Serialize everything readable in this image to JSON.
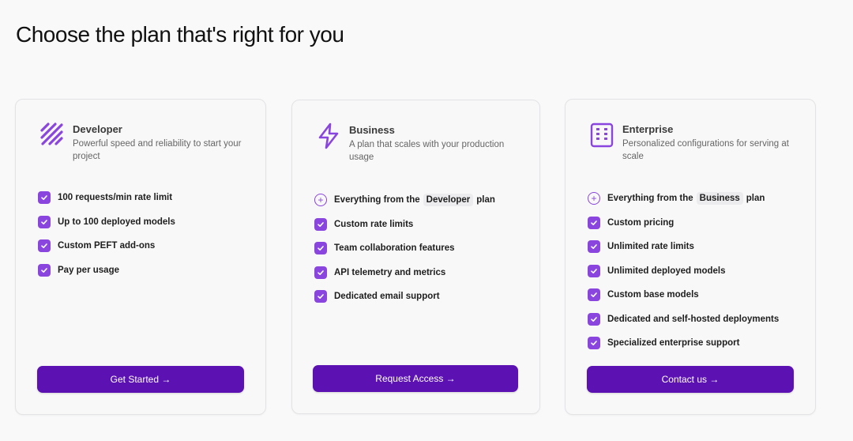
{
  "page": {
    "title": "Choose the plan that's right for you"
  },
  "plans": [
    {
      "name": "Developer",
      "description": "Powerful speed and reliability to start your project",
      "icon": "diagonal-stripes-icon",
      "features": [
        "100 requests/min rate limit",
        "Up to 100 deployed models",
        "Custom PEFT add-ons",
        "Pay per usage"
      ],
      "cta": "Get Started →"
    },
    {
      "name": "Business",
      "description": "A plan that scales with your production usage",
      "icon": "lightning-bolt-icon",
      "inherits": {
        "prefix": "Everything from the",
        "plan": "Developer",
        "suffix": "plan"
      },
      "features": [
        "Custom rate limits",
        "Team collaboration features",
        "API telemetry and metrics",
        "Dedicated email support"
      ],
      "cta": "Request Access →"
    },
    {
      "name": "Enterprise",
      "description": "Personalized configurations for serving at scale",
      "icon": "building-icon",
      "inherits": {
        "prefix": "Everything from the",
        "plan": "Business",
        "suffix": "plan"
      },
      "features": [
        "Custom pricing",
        "Unlimited rate limits",
        "Unlimited deployed models",
        "Custom base models",
        "Dedicated and self-hosted deployments",
        "Specialized enterprise support"
      ],
      "cta": "Contact us →"
    }
  ],
  "colors": {
    "accent": "#8a45df",
    "button": "#5c12b3",
    "background": "#f9f9fa"
  }
}
